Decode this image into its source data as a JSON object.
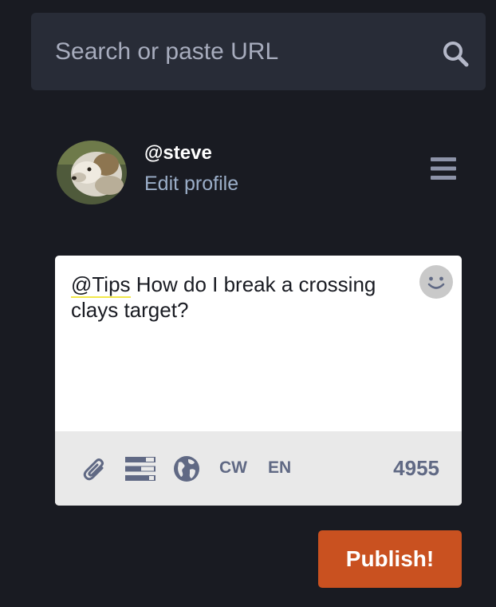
{
  "search": {
    "placeholder": "Search or paste URL",
    "icon": "search-icon"
  },
  "profile": {
    "handle": "@steve",
    "edit_label": "Edit profile",
    "menu_icon": "hamburger-menu-icon"
  },
  "compose": {
    "mention": "@Tips",
    "text": " How do I break a crossing clays target?",
    "emoji_icon": "smiley-face-icon",
    "toolbar": {
      "attach_icon": "paperclip-icon",
      "poll_icon": "poll-icon",
      "visibility_icon": "globe-icon",
      "cw_label": "CW",
      "language_label": "EN",
      "char_count": "4955"
    }
  },
  "publish": {
    "label": "Publish!"
  },
  "colors": {
    "background": "#191b22",
    "panel": "#282c37",
    "accent": "#c95120",
    "muted_text": "#9baec8",
    "toolbar_text": "#606984",
    "mention_underline": "#f2e84a"
  }
}
